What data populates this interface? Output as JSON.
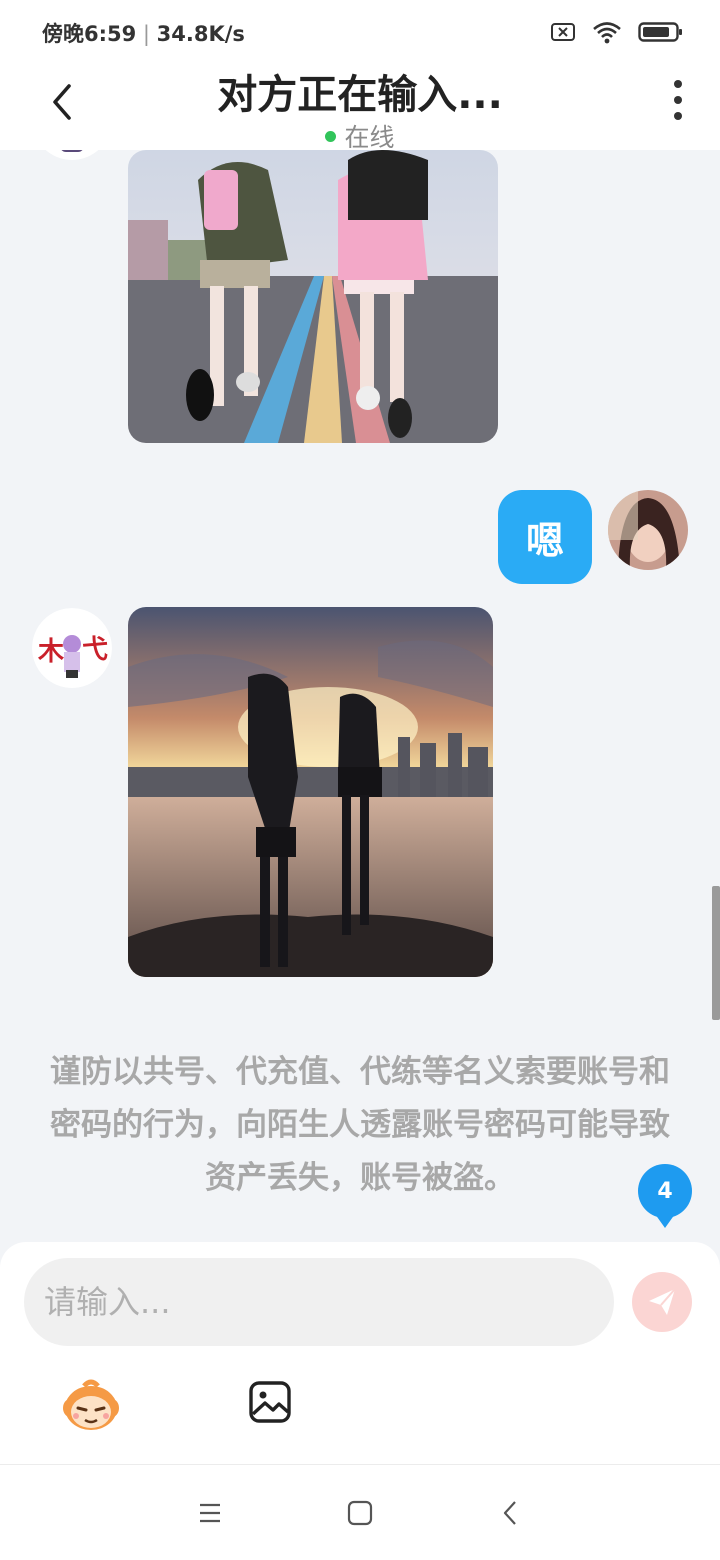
{
  "status_bar": {
    "time": "傍晚6:59",
    "speed": "34.8K/s"
  },
  "header": {
    "title": "对方正在输入...",
    "status": "在线"
  },
  "messages": {
    "sent_text": "嗯",
    "notice": "谨防以共号、代充值、代练等名义索要账号和密码的行为，向陌生人透露账号密码可能导致资产丢失，账号被盗。"
  },
  "unread_badge": "4",
  "input": {
    "placeholder": "请输入..."
  },
  "colors": {
    "bubble": "#2aabf5",
    "badge": "#1e9bf0",
    "online_dot": "#31c45a",
    "send_button": "#fbd5d3"
  },
  "icons": [
    "back-arrow-icon",
    "more-dots-icon",
    "send-icon",
    "emoji-icon",
    "image-icon",
    "menu-icon",
    "home-square-icon",
    "nav-back-icon"
  ]
}
